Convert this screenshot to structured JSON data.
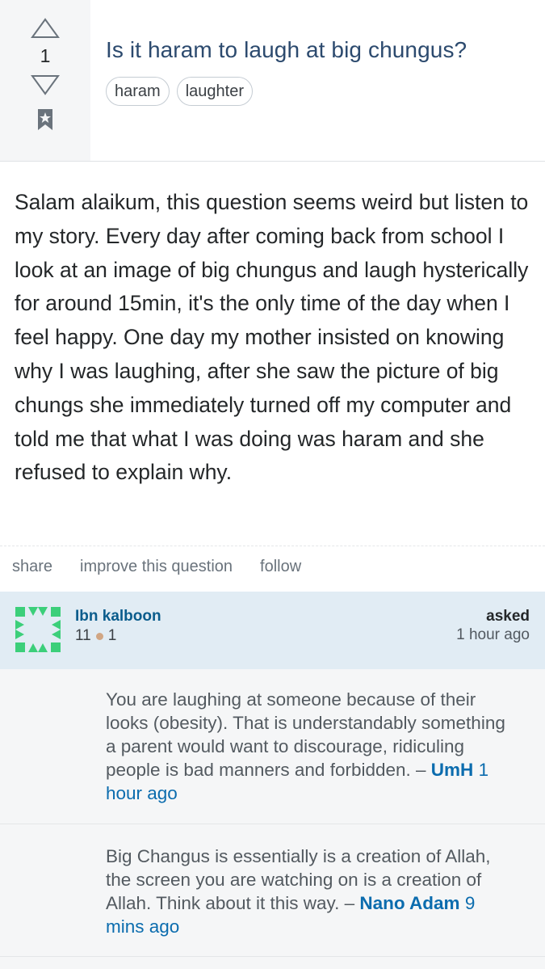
{
  "question": {
    "vote_count": "1",
    "title": "Is it haram to laugh at big chungus?",
    "tags": [
      "haram",
      "laughter"
    ],
    "body": "Salam alaikum, this question seems weird but listen to my story. Every day after coming back from school I look at an image of big chungus and laugh hysterically for around 15min, it's the only time of the day when I feel happy. One day my mother insisted on knowing why I was laughing, after she saw the picture of big chungs she immediately turned off my computer and told me that what I was doing was haram and she refused to explain why."
  },
  "actions": {
    "share": "share",
    "improve": "improve this question",
    "follow": "follow"
  },
  "user": {
    "name": "Ibn kalboon",
    "reputation": "11",
    "bronze": "1",
    "asked_label": "asked",
    "asked_time": "1 hour ago"
  },
  "comments": [
    {
      "text": "You are laughing at someone because of their looks (obesity). That is understandably something a parent would want to discourage, ridiculing people is bad manners and forbidden.",
      "dash": " – ",
      "author": "UmH",
      "time": "1 hour ago"
    },
    {
      "text": "Big Changus is essentially is a creation of Allah, the screen you are watching on is a creation of Allah. Think about it this way.",
      "dash": " – ",
      "author": "Nano Adam",
      "time": "9 mins ago"
    }
  ],
  "icons": {
    "upvote": "upvote-arrow-icon",
    "downvote": "downvote-arrow-icon",
    "bookmark": "bookmark-icon",
    "avatar": "identicon-avatar"
  },
  "colors": {
    "title": "#2c4a6e",
    "link": "#0b6cae",
    "user_card_bg": "#e1ecf4",
    "side_bg": "#f5f6f7",
    "identicon": "#3ccf7a"
  }
}
